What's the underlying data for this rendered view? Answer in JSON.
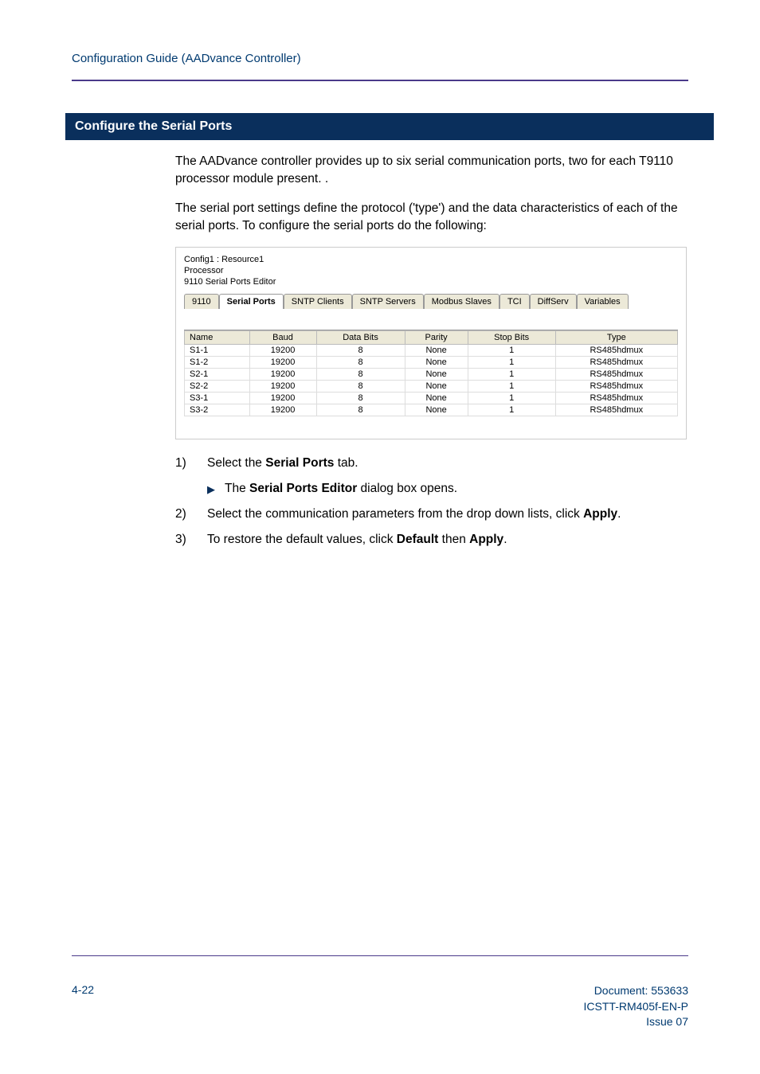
{
  "header": {
    "title": "Configuration Guide (AADvance Controller)"
  },
  "section": {
    "title": "Configure the Serial Ports",
    "para1": "The AADvance controller provides up to six serial communication ports, two for each T9110 processor module present. .",
    "para2": "The serial port settings define the protocol ('type') and the data characteristics of each of the serial ports. To configure the serial ports do the following:"
  },
  "screenshot": {
    "line1": "Config1 : Resource1",
    "line2": "Processor",
    "line3": "9110 Serial Ports Editor",
    "tabs": [
      "9110",
      "Serial Ports",
      "SNTP Clients",
      "SNTP Servers",
      "Modbus Slaves",
      "TCI",
      "DiffServ",
      "Variables"
    ],
    "active_tab_index": 1,
    "columns": [
      "Name",
      "Baud",
      "Data Bits",
      "Parity",
      "Stop Bits",
      "Type"
    ],
    "rows": [
      [
        "S1-1",
        "19200",
        "8",
        "None",
        "1",
        "RS485hdmux"
      ],
      [
        "S1-2",
        "19200",
        "8",
        "None",
        "1",
        "RS485hdmux"
      ],
      [
        "S2-1",
        "19200",
        "8",
        "None",
        "1",
        "RS485hdmux"
      ],
      [
        "S2-2",
        "19200",
        "8",
        "None",
        "1",
        "RS485hdmux"
      ],
      [
        "S3-1",
        "19200",
        "8",
        "None",
        "1",
        "RS485hdmux"
      ],
      [
        "S3-2",
        "19200",
        "8",
        "None",
        "1",
        "RS485hdmux"
      ]
    ]
  },
  "steps": {
    "s1_num": "1)",
    "s1_a": "Select the ",
    "s1_b": "Serial Ports",
    "s1_c": " tab.",
    "s1_sub_a": "The ",
    "s1_sub_b": "Serial Ports Editor",
    "s1_sub_c": " dialog box opens.",
    "s2_num": "2)",
    "s2_a": "Select the communication parameters from the drop down lists, click ",
    "s2_b": "Apply",
    "s2_c": ".",
    "s3_num": "3)",
    "s3_a": "To restore the default values, click ",
    "s3_b": "Default",
    "s3_c": " then ",
    "s3_d": "Apply",
    "s3_e": "."
  },
  "footer": {
    "left": "4-22",
    "right1": "Document: 553633",
    "right2": "ICSTT-RM405f-EN-P",
    "right3": "Issue 07"
  }
}
